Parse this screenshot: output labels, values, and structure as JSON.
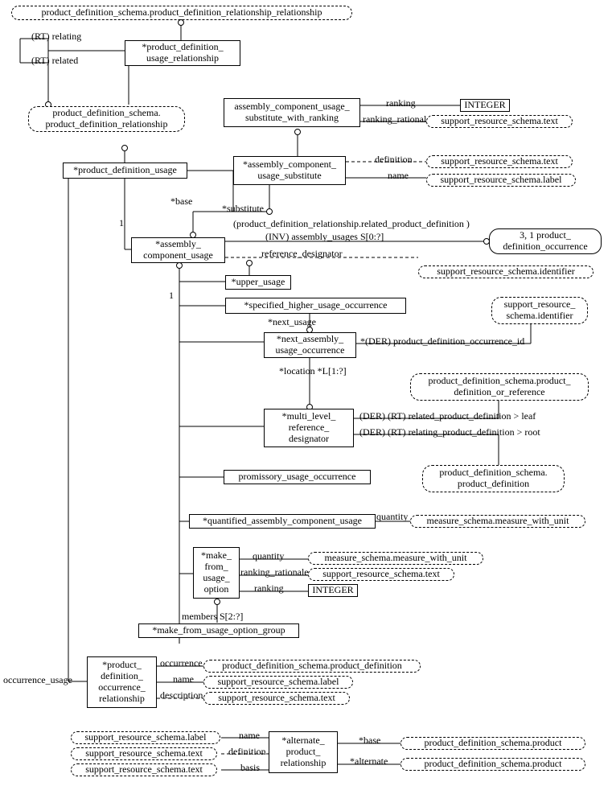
{
  "nodes": {
    "pdrr": "product_definition_schema.product_definition_relationship_relationship",
    "pdur": "*product_definition_\nusage_relationship",
    "pds_pdr": "product_definition_schema.\nproduct_definition_relationship",
    "pdu": "*product_definition_usage",
    "acuswr": "assembly_component_usage_\nsubstitute_with_ranking",
    "acus": "*assembly_component_\nusage_substitute",
    "integer1": "INTEGER",
    "srs_text1": "support_resource_schema.text",
    "srs_text2": "support_resource_schema.text",
    "srs_label1": "support_resource_schema.label",
    "acu": "*assembly_\ncomponent_usage",
    "pdo": "3, 1 product_\ndefinition_occurrence",
    "srs_ident1": "support_resource_schema.identifier",
    "upper_usage": "*upper_usage",
    "shuo": "*specified_higher_usage_occurrence",
    "srs_ident2": "support_resource_\nschema.identifier",
    "nauo": "*next_assembly_\nusage_occurrence",
    "mlrd": "*multi_level_\nreference_\ndesignator",
    "pds_pdor": "product_definition_schema.product_\ndefinition_or_reference",
    "pds_pd": "product_definition_schema.\nproduct_definition",
    "puo": "promissory_usage_occurrence",
    "qacu": "*quantified_assembly_component_usage",
    "ms_mwu1": "measure_schema.measure_with_unit",
    "mfuo": "*make_\nfrom_\nusage_\noption",
    "ms_mwu2": "measure_schema.measure_with_unit",
    "srs_text3": "support_resource_schema.text",
    "integer2": "INTEGER",
    "mfuog": "*make_from_usage_option_group",
    "pdor": "*product_\ndefinition_\noccurrence_\nrelationship",
    "pds_pd2": "product_definition_schema.product_definition",
    "srs_label2": "support_resource_schema.label",
    "srs_text4": "support_resource_schema.text",
    "apr": "*alternate_\nproduct_\nrelationship",
    "srs_label3": "support_resource_schema.label",
    "srs_text5": "support_resource_schema.text",
    "srs_text6": "support_resource_schema.text",
    "pds_p1": "product_definition_schema.product",
    "pds_p2": "product_definition_schema.product"
  },
  "labels": {
    "rt_relating": "(RT) relating",
    "rt_related": "(RT) related",
    "ranking": "ranking",
    "ranking_rationale1": "ranking_rationale",
    "definition1": "definition",
    "name1": "name",
    "base1": "*base",
    "substitute": "*substitute",
    "prr_paren": "(product_definition_relationship.related_product_definition )",
    "inv_au": "(INV) assembly_usages S[0:?]",
    "ref_des": "reference_designator",
    "one_a": "1",
    "one_b": "1",
    "next_usage": "*next_usage",
    "der_pdoi": "*(DER) product_definition_occurrence_id",
    "location": "*location *L[1:?]",
    "der_rt_rel": "(DER) (RT) related_product_definition > leaf",
    "der_rt_relat": "(DER) (RT) relating_product_definition > root",
    "quantity1": "quantity",
    "quantity2": "quantity",
    "ranking_rationale2": "ranking_rationale",
    "ranking2": "ranking",
    "members": "members S[2:?]",
    "occurrence": "occurrence",
    "name2": "name",
    "description2": "description",
    "occurrence_usage": "occurrence_usage",
    "name3": "name",
    "definition3": "definition",
    "basis": "basis",
    "base2": "*base",
    "alternate": "*alternate"
  }
}
